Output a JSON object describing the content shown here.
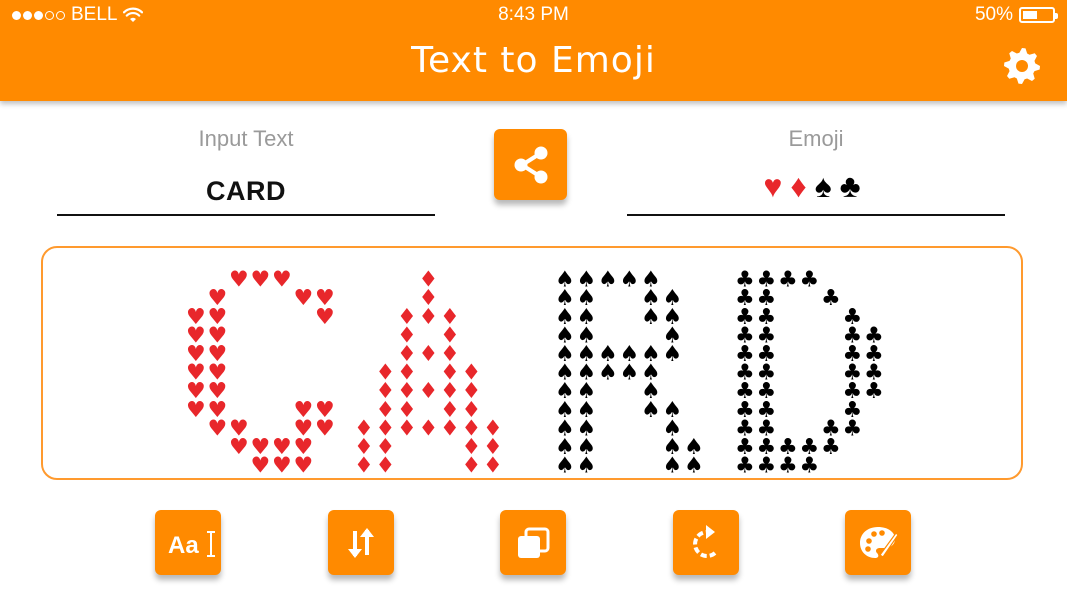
{
  "status_bar": {
    "carrier": "BELL",
    "time": "8:43 PM",
    "battery": "50%",
    "battery_level": 0.5,
    "signal_bars_filled": 3,
    "signal_bars_total": 5
  },
  "header": {
    "title": "Text to Emoji",
    "settings_icon": "gear-icon",
    "background_color": "#FF8A00"
  },
  "input": {
    "label": "Input Text",
    "value": "CARD"
  },
  "emoji": {
    "label": "Emoji",
    "suits": [
      {
        "symbol": "♥",
        "color": "#E8272B"
      },
      {
        "symbol": "♦",
        "color": "#E8272B"
      },
      {
        "symbol": "♠",
        "color": "#000000"
      },
      {
        "symbol": "♣",
        "color": "#000000"
      }
    ]
  },
  "share_icon": "share-icon",
  "art": {
    "text": "CARD",
    "letters": [
      {
        "char": "C",
        "suit": "♥",
        "color": "#E8272B"
      },
      {
        "char": "A",
        "suit": "♦",
        "color": "#E8272B"
      },
      {
        "char": "R",
        "suit": "♠",
        "color": "#000000"
      },
      {
        "char": "D",
        "suit": "♣",
        "color": "#000000"
      }
    ]
  },
  "toolbar": [
    {
      "name": "font-button",
      "icon": "font-size-icon"
    },
    {
      "name": "swap-button",
      "icon": "swap-vertical-icon"
    },
    {
      "name": "copy-button",
      "icon": "copy-icon"
    },
    {
      "name": "reset-button",
      "icon": "rotate-icon"
    },
    {
      "name": "palette-button",
      "icon": "palette-icon"
    }
  ]
}
